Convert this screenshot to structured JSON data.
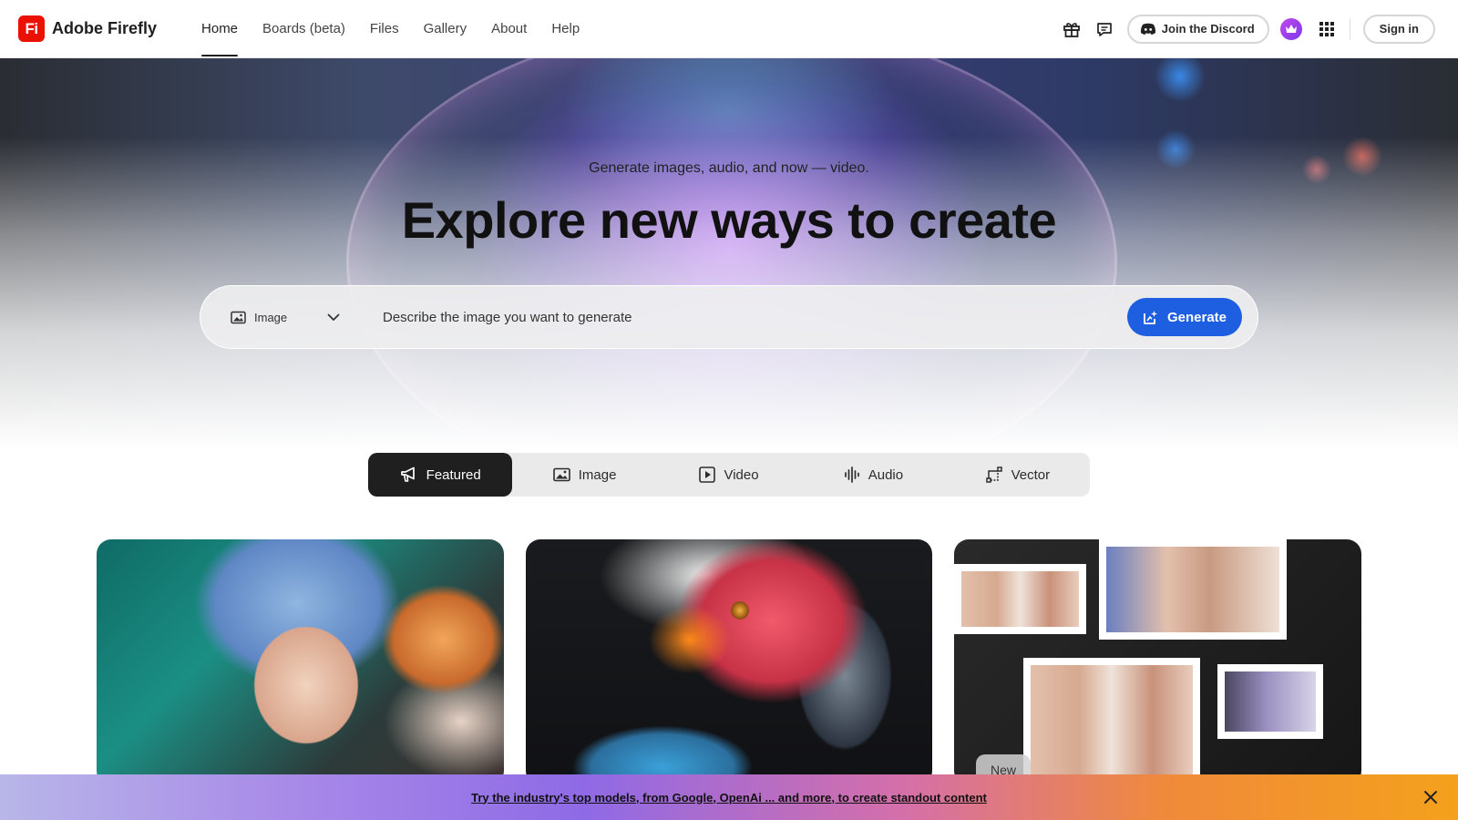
{
  "header": {
    "logo_text": "Fi",
    "brand": "Adobe Firefly",
    "nav": [
      {
        "label": "Home",
        "active": true
      },
      {
        "label": "Boards (beta)"
      },
      {
        "label": "Files"
      },
      {
        "label": "Gallery"
      },
      {
        "label": "About"
      },
      {
        "label": "Help"
      }
    ],
    "discord_label": "Join the Discord",
    "signin_label": "Sign in",
    "icons": [
      "gift-icon",
      "chat-feedback-icon",
      "discord-icon",
      "crown-icon",
      "apps-grid-icon"
    ]
  },
  "hero": {
    "subtitle": "Generate images, audio, and now — video.",
    "title": "Explore new ways to create",
    "type_select": {
      "selected": "Image"
    },
    "prompt_placeholder": "Describe the image you want to generate",
    "generate_label": "Generate"
  },
  "tabs": [
    {
      "label": "Featured",
      "icon": "megaphone-icon",
      "active": true
    },
    {
      "label": "Image",
      "icon": "image-icon"
    },
    {
      "label": "Video",
      "icon": "video-play-icon"
    },
    {
      "label": "Audio",
      "icon": "audio-wave-icon"
    },
    {
      "label": "Vector",
      "icon": "vector-icon"
    }
  ],
  "cards": {
    "third_badge": "New"
  },
  "banner": {
    "text": "Try the industry's top models, from Google, OpenAi ... and more, to create standout content"
  },
  "colors": {
    "brand_red": "#eb1000",
    "generate_blue": "#1d5fe0",
    "active_tab": "#1f1f1f"
  }
}
